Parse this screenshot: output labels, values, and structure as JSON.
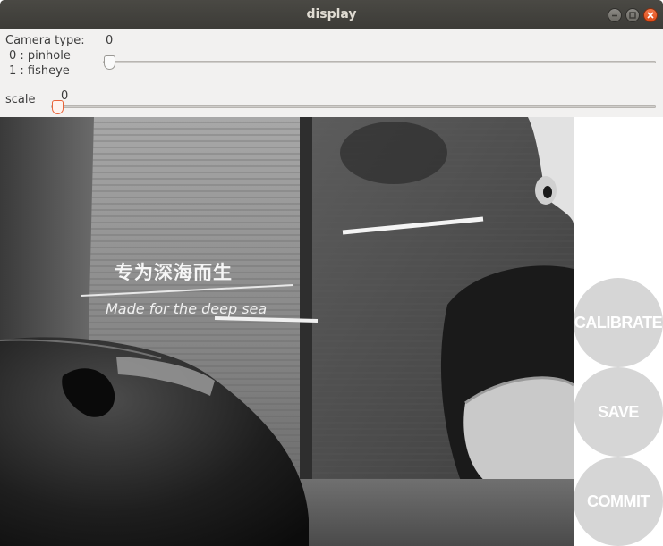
{
  "window": {
    "title": "display"
  },
  "controls": {
    "camera_type": {
      "label_line1": "Camera type:",
      "label_line2": "0 : pinhole",
      "label_line3": "1 : fisheye",
      "value": "0"
    },
    "scale": {
      "label": "scale",
      "value": "0"
    }
  },
  "camera_view": {
    "overlay_text_cn": "专为深海而生",
    "overlay_text_en": "Made for the deep sea"
  },
  "buttons": {
    "calibrate": "CALIBRATE",
    "save": "SAVE",
    "commit": "COMMIT"
  },
  "colors": {
    "titlebar": "#3c3b37",
    "panel_bg": "#f2f1f0",
    "close_button": "#df4a16",
    "round_button": "#d6d6d6",
    "active_slider_knob": "#e9643a"
  },
  "icons": {
    "minimize": "minimize-icon",
    "maximize": "maximize-icon",
    "close": "close-icon"
  }
}
